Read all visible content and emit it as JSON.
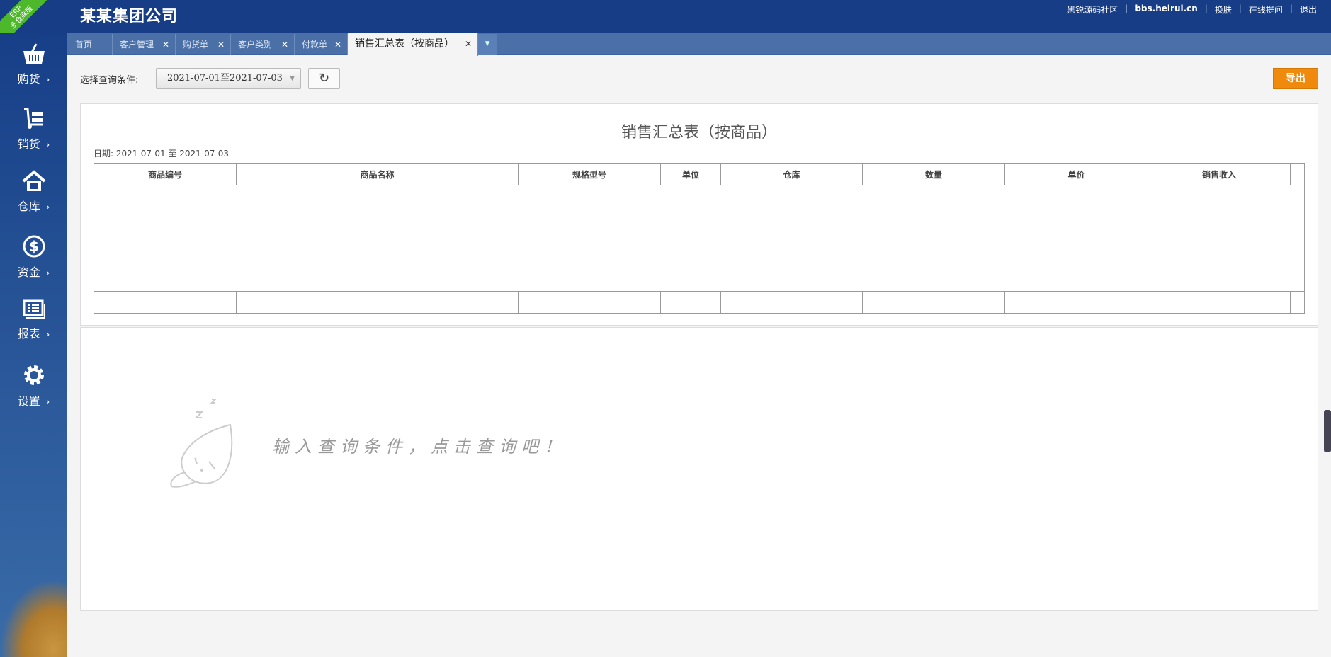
{
  "header": {
    "brand": "某某集团公司",
    "ribbon_top": "ERP",
    "ribbon_bottom": "多仓库版",
    "links": [
      "黑锐源码社区",
      "bbs.heirui.cn",
      "换肤",
      "在线提问",
      "退出"
    ]
  },
  "sidebar": {
    "items": [
      {
        "label": "购货",
        "icon": "basket-icon"
      },
      {
        "label": "销货",
        "icon": "cart-icon"
      },
      {
        "label": "仓库",
        "icon": "warehouse-icon"
      },
      {
        "label": "资金",
        "icon": "dollar-icon"
      },
      {
        "label": "报表",
        "icon": "report-icon"
      },
      {
        "label": "设置",
        "icon": "gear-icon"
      }
    ],
    "chevron": "›"
  },
  "tabs": [
    {
      "label": "首页"
    },
    {
      "label": "客户管理"
    },
    {
      "label": "购货单"
    },
    {
      "label": "客户类别"
    },
    {
      "label": "付款单"
    },
    {
      "label": "销售汇总表（按商品）"
    }
  ],
  "tab_close": "✕",
  "filter": {
    "label": "选择查询条件:",
    "date_range": "2021-07-01至2021-07-03",
    "export_label": "导出"
  },
  "report": {
    "title": "销售汇总表（按商品）",
    "date_line": "日期: 2021-07-01 至 2021-07-03",
    "columns": [
      "商品编号",
      "商品名称",
      "规格型号",
      "单位",
      "仓库",
      "数量",
      "单价",
      "销售收入"
    ]
  },
  "empty_hint": "输入查询条件，点击查询吧！"
}
